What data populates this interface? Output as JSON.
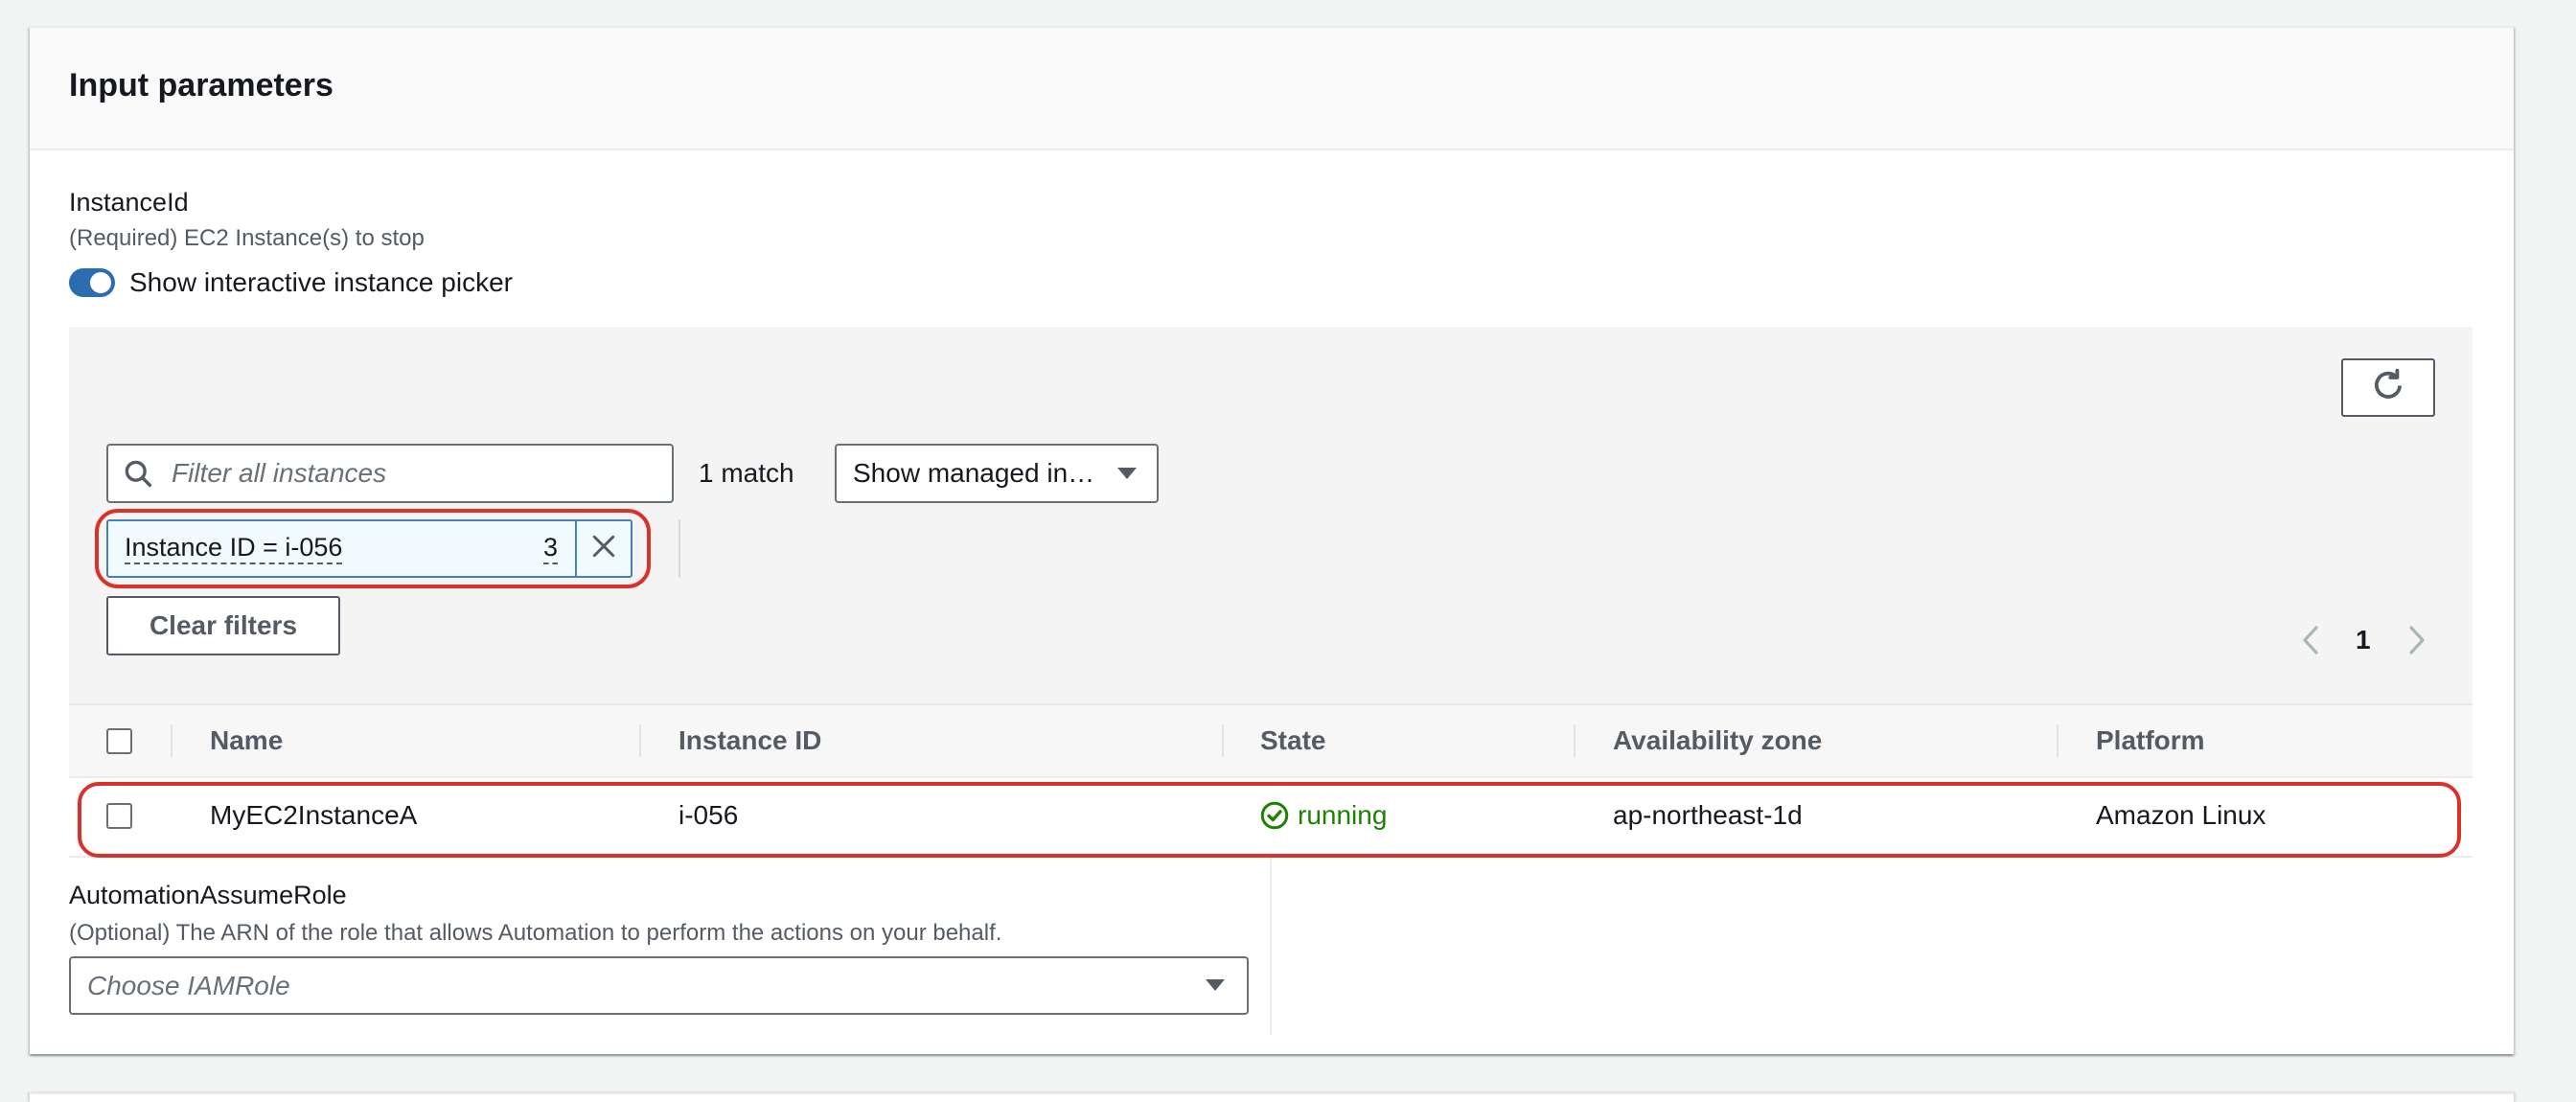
{
  "panel": {
    "title": "Input parameters"
  },
  "instance_id": {
    "label": "InstanceId",
    "description": "(Required) EC2 Instance(s) to stop",
    "toggle": {
      "label": "Show interactive instance picker",
      "checked": true
    }
  },
  "picker": {
    "filter": {
      "placeholder": "Filter all instances"
    },
    "match_count": "1 match",
    "managed_select": {
      "selected": "Show managed in…"
    },
    "token": {
      "text": "Instance ID = i-056",
      "tail": "3"
    },
    "clear_filters_label": "Clear filters",
    "pagination": {
      "current_page": "1"
    },
    "table": {
      "columns": [
        "Name",
        "Instance ID",
        "State",
        "Availability zone",
        "Platform"
      ],
      "select_all_checked": false,
      "rows": [
        {
          "checked": false,
          "name": "MyEC2InstanceA",
          "instance_id": "i-056",
          "state": "running",
          "availability_zone": "ap-northeast-1d",
          "platform": "Amazon Linux"
        }
      ]
    }
  },
  "automation_assume_role": {
    "label": "AutomationAssumeRole",
    "description": "(Optional) The ARN of the role that allows Automation to perform the actions on your behalf.",
    "select": {
      "placeholder": "Choose IAMRole"
    }
  },
  "icons": {
    "search": "search-icon",
    "dropdown": "caret-down-icon",
    "token_dismiss": "close-icon",
    "refresh": "refresh-icon",
    "prev_page": "chevron-left-icon",
    "next_page": "chevron-right-icon",
    "status": "status-check-icon"
  },
  "colors": {
    "accent": "#2c6cb0",
    "highlight": "#d9322b",
    "status_running": "#1d8102"
  }
}
